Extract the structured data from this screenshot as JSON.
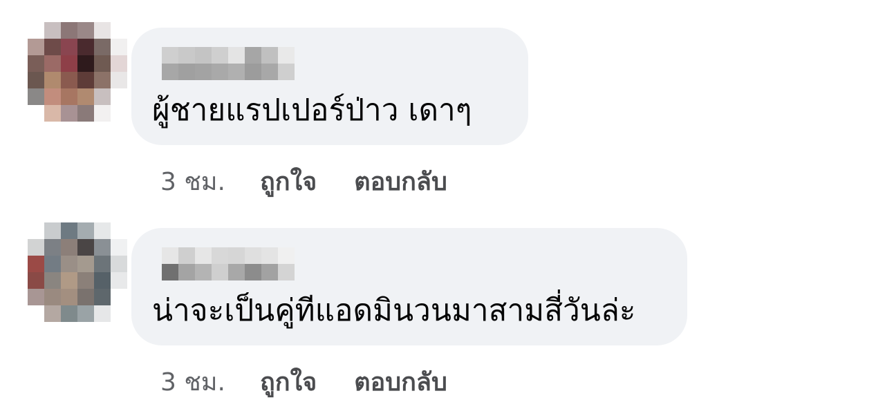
{
  "comments": [
    {
      "text": "ผู้ชายแรปเปอร์ป่าว เดาๆ",
      "time": "3 ชม.",
      "like_label": "ถูกใจ",
      "reply_label": "ตอบกลับ"
    },
    {
      "text": "น่าจะเป็นคู่ทีแอดมินวนมาสามสี่วันล่ะ",
      "time": "3 ชม.",
      "like_label": "ถูกใจ",
      "reply_label": "ตอบกลับ"
    }
  ],
  "colors": {
    "bubble": "#f0f2f5",
    "text": "#050505",
    "meta": "#606266"
  },
  "avatars": [
    [
      "#ffffff",
      "#c8bfc0",
      "#8c7777",
      "#9a8888",
      "#e8e4e4",
      "#ffffff",
      "#b39a95",
      "#6e4b49",
      "#8a4550",
      "#4a2a2e",
      "#7a6a66",
      "#f1f0f0",
      "#7a5e58",
      "#9b6a66",
      "#8e3f48",
      "#2e1a1c",
      "#6f5a52",
      "#e3d6d6",
      "#6b5750",
      "#b08a6e",
      "#8a5a4f",
      "#5e3c38",
      "#8c7268",
      "#e9e7e7",
      "#8a8887",
      "#c28d7d",
      "#a77662",
      "#b08a70",
      "#c8bfbf",
      "#ffffff",
      "#ffffff",
      "#d9b8a8",
      "#a89294",
      "#8a7a79",
      "#f2f0f0",
      "#ffffff"
    ],
    [
      "#ffffff",
      "#c9ccce",
      "#6e7a82",
      "#a4acb0",
      "#e6e8e9",
      "#ffffff",
      "#d2d3d3",
      "#7c8085",
      "#8c7f79",
      "#4a4545",
      "#8a9095",
      "#f0f1f2",
      "#9b4a46",
      "#737c84",
      "#9a8f87",
      "#a49a8f",
      "#6c7479",
      "#d8dadb",
      "#8a4a46",
      "#8a8580",
      "#b09a86",
      "#8b8079",
      "#566168",
      "#e8e9ea",
      "#a89694",
      "#9a8a80",
      "#a38f80",
      "#7a726e",
      "#5e676c",
      "#ffffff",
      "#ffffff",
      "#b4a8a2",
      "#7f8a8c",
      "#9aa3a6",
      "#e6e7e8",
      "#ffffff"
    ]
  ],
  "name_blurs": [
    [
      "#cfcfcf",
      "#a7a7a7",
      "#c9c9c9",
      "#a0a0a0",
      "#c4c4c4",
      "#a3a3a3",
      "#cfcfcf",
      "#a9a9a9",
      "#e4e4e4",
      "#b0b0b0",
      "#a6a6a6",
      "#9c9c9c",
      "#c0c0c0",
      "#a8a8a8",
      "#e9e9e9",
      "#cfcfcf"
    ],
    [
      "#e6e6e6",
      "#707070",
      "#cfcfcf",
      "#a4a4a4",
      "#e6e6e6",
      "#b4b4b4",
      "#d8d8d8",
      "#cfcfcf",
      "#d6d6d6",
      "#a8a8a8",
      "#dfdfdf",
      "#8c8c8c",
      "#e4e4e4",
      "#a2a2a2",
      "#f0f0f0",
      "#d4d4d4"
    ]
  ]
}
